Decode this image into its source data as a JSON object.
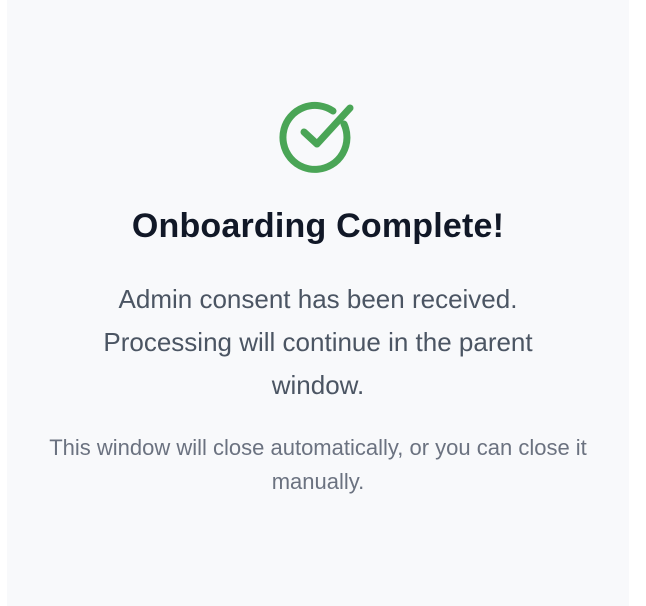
{
  "status": {
    "icon": "check-circle-icon",
    "icon_color": "#4aa556",
    "title": "Onboarding Complete!",
    "message": "Admin consent has been received. Processing will continue in the parent window.",
    "note": "This window will close automatically, or you can close it manually."
  }
}
